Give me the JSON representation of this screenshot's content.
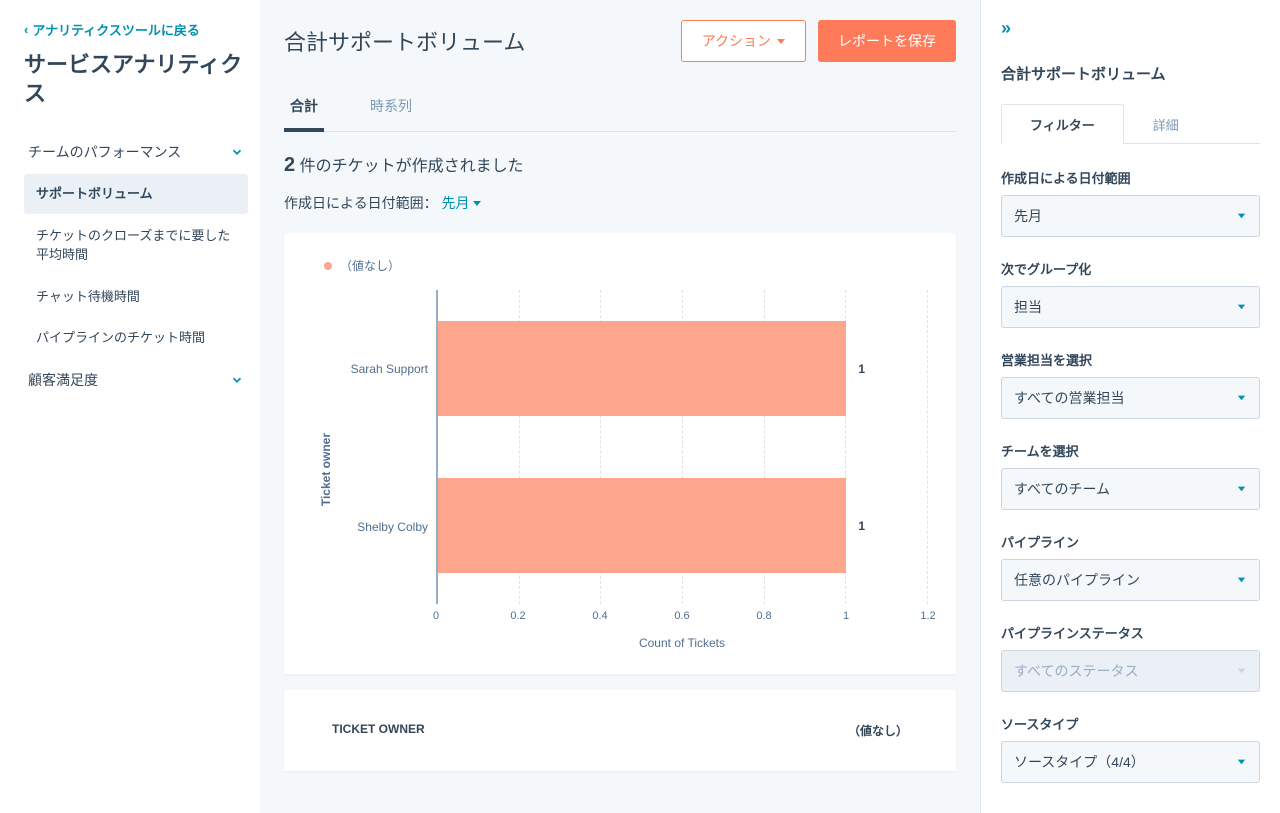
{
  "sidebar": {
    "back_link": "アナリティクスツールに戻る",
    "title": "サービスアナリティクス",
    "sections": [
      {
        "label": "チームのパフォーマンス",
        "items": [
          "サポートボリューム",
          "チケットのクローズまでに要した平均時間",
          "チャット待機時間",
          "パイプラインのチケット時間"
        ]
      },
      {
        "label": "顧客満足度"
      }
    ]
  },
  "main": {
    "title": "合計サポートボリューム",
    "actions_button": "アクション",
    "save_button": "レポートを保存",
    "tabs": [
      "合計",
      "時系列"
    ],
    "summary_count": "2",
    "summary_text": "件のチケットが作成されました",
    "date_range_label": "作成日による日付範囲：",
    "date_range_value": "先月"
  },
  "chart_data": {
    "type": "bar",
    "legend": "（値なし）",
    "ylabel": "Ticket owner",
    "xlabel": "Count of Tickets",
    "categories": [
      "Sarah Support",
      "Shelby Colby"
    ],
    "values": [
      1,
      1
    ],
    "xticks": [
      "0",
      "0.2",
      "0.4",
      "0.6",
      "0.8",
      "1",
      "1.2"
    ],
    "xmax": 1.2
  },
  "table": {
    "col1": "TICKET OWNER",
    "col2": "（値なし）"
  },
  "panel": {
    "title": "合計サポートボリューム",
    "tabs": [
      "フィルター",
      "詳細"
    ],
    "fields": [
      {
        "label": "作成日による日付範囲",
        "value": "先月"
      },
      {
        "label": "次でグループ化",
        "value": "担当"
      },
      {
        "label": "営業担当を選択",
        "value": "すべての営業担当"
      },
      {
        "label": "チームを選択",
        "value": "すべてのチーム"
      },
      {
        "label": "パイプライン",
        "value": "任意のパイプライン"
      },
      {
        "label": "パイプラインステータス",
        "value": "すべてのステータス",
        "disabled": true
      },
      {
        "label": "ソースタイプ",
        "value": "ソースタイプ（4/4）"
      }
    ]
  }
}
